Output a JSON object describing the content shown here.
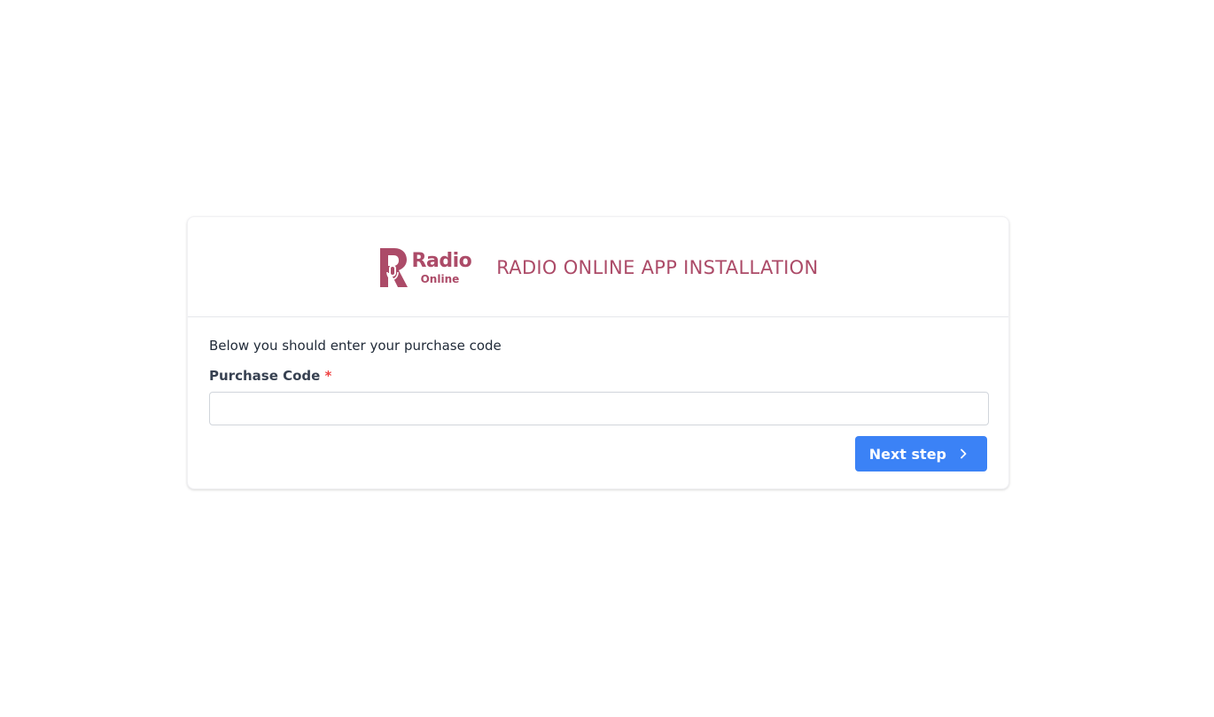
{
  "header": {
    "logo": {
      "word": "Radio",
      "sub": "Online"
    },
    "title": "RADIO ONLINE APP INSTALLATION"
  },
  "form": {
    "intro": "Below you should enter your purchase code",
    "purchase_code_label": "Purchase Code",
    "required_mark": "*",
    "purchase_code_value": "",
    "purchase_code_placeholder": "",
    "next_button_label": "Next step"
  },
  "colors": {
    "brand": "#ac4b68",
    "primary_button": "#3b82f6",
    "required": "#ef4444"
  },
  "icons": {
    "logo": "radio-logo-icon",
    "next": "chevron-right-icon"
  }
}
